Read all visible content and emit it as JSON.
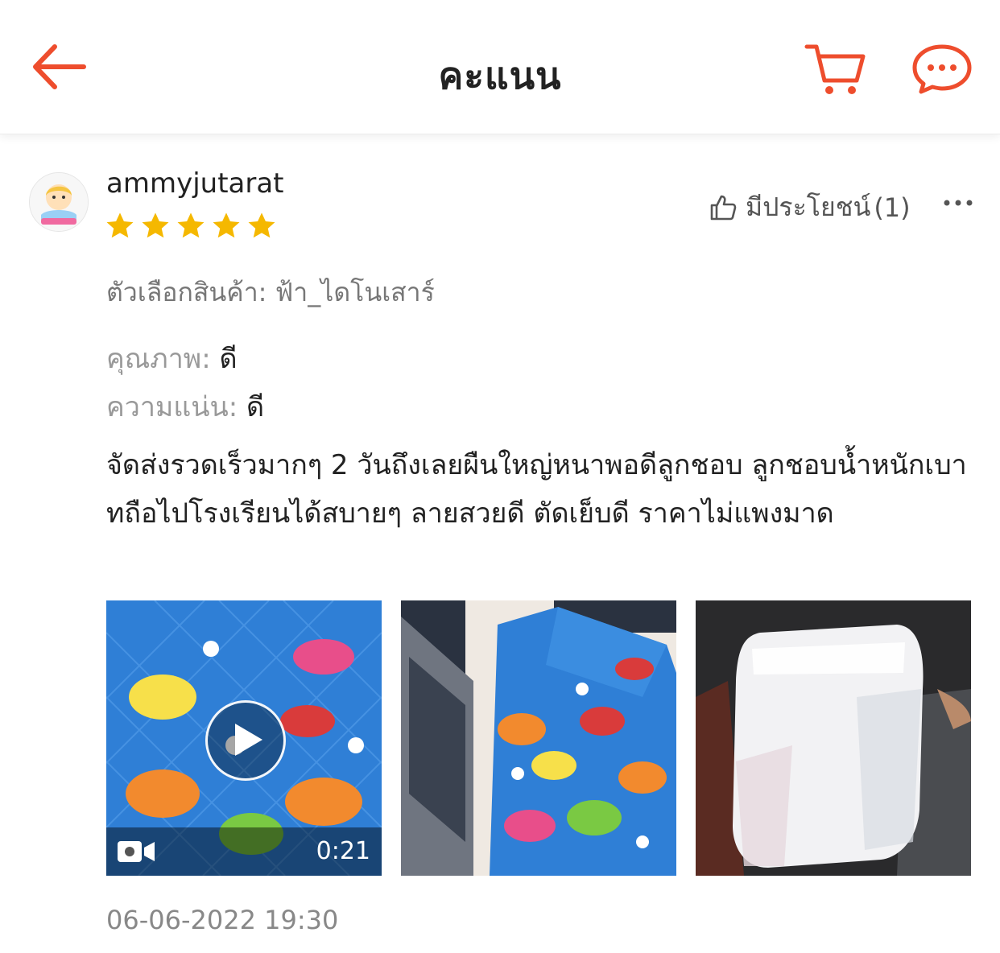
{
  "header": {
    "title": "คะแนน",
    "accent_color": "#ee4d2d"
  },
  "review": {
    "username": "ammyjutarat",
    "rating": 5,
    "helpful_label": "มีประโยชน์",
    "helpful_count": "(1)",
    "variant_label": "ตัวเลือกสินค้า:",
    "variant_value": "ฟ้า_ไดโนเสาร์",
    "attributes": [
      {
        "label": "คุณภาพ:",
        "value": "ดี"
      },
      {
        "label": "ความแน่น:",
        "value": "ดี"
      }
    ],
    "comment": "จัดส่งรวดเร็วมากๆ 2 วันถึงเลยผืนใหญ่หนาพอดีลูกชอบ ลูกชอบน้ำหนักเบาทถือไปโรงเรียนได้สบายๆ ลายสวยดี ตัดเย็บดี ราคาไม่แพงมาด",
    "media": [
      {
        "type": "video",
        "duration": "0:21"
      },
      {
        "type": "image"
      },
      {
        "type": "image"
      }
    ],
    "timestamp": "06-06-2022 19:30"
  },
  "icons": {
    "back": "arrow-left-icon",
    "cart": "cart-icon",
    "chat": "chat-icon",
    "helpful": "thumbs-up-icon",
    "more": "more-dots-icon",
    "star": "star-icon",
    "play": "play-icon",
    "video": "video-camera-icon"
  },
  "colors": {
    "star": "#f5b800",
    "text_primary": "#222222",
    "text_secondary": "#888888"
  }
}
